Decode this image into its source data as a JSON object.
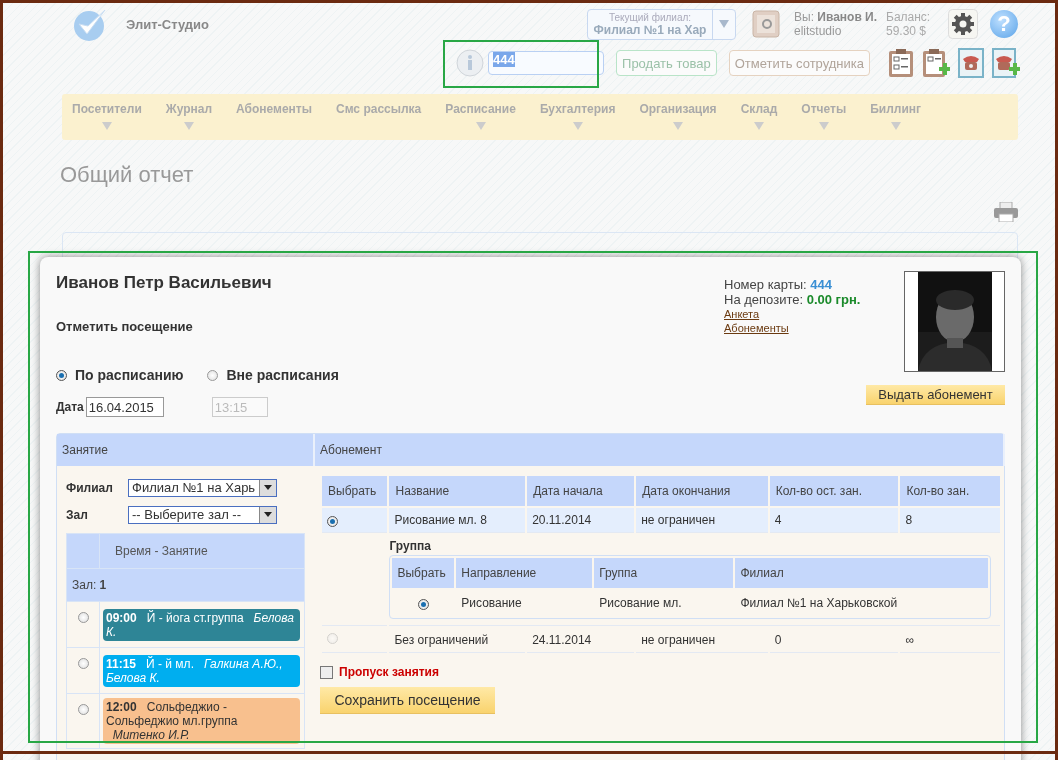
{
  "header": {
    "logo_text": "Элит-Студио",
    "branch_selector": {
      "label": "Текущий филиал:",
      "value": "Филиал №1 на Хар"
    },
    "user": {
      "prefix": "Вы:",
      "name": "Иванов И.",
      "login": "elitstudio"
    },
    "balance": {
      "label": "Баланс:",
      "value": "59.30 $"
    },
    "help": "?"
  },
  "search": {
    "value": "444"
  },
  "actions": [
    {
      "label": "Продать товар",
      "kind": "green"
    },
    {
      "label": "Отметить сотрудника",
      "kind": "brown"
    }
  ],
  "nav": [
    {
      "label": "Посетители",
      "has_menu": true
    },
    {
      "label": "Журнал",
      "has_menu": true
    },
    {
      "label": "Абонементы",
      "has_menu": false
    },
    {
      "label": "Смс рассылка",
      "has_menu": false
    },
    {
      "label": "Расписание",
      "has_menu": true
    },
    {
      "label": "Бухгалтерия",
      "has_menu": true
    },
    {
      "label": "Организация",
      "has_menu": true
    },
    {
      "label": "Склад",
      "has_menu": true
    },
    {
      "label": "Отчеты",
      "has_menu": true
    },
    {
      "label": "Биллинг",
      "has_menu": true
    }
  ],
  "page_title": "Общий отчет",
  "modal": {
    "client_name": "Иванов Петр Васильевич",
    "section_title": "Отметить посещение",
    "card": {
      "number_label": "Номер карты:",
      "number": "444",
      "deposit_label": "На депозите:",
      "deposit": "0.00 грн."
    },
    "links": [
      "Анкета",
      "Абонементы"
    ],
    "issue_button": "Выдать абонемент",
    "modes": [
      {
        "label": "По расписанию",
        "selected": true
      },
      {
        "label": "Вне расписания",
        "selected": false
      }
    ],
    "date_label": "Дата",
    "date": "16.04.2015",
    "time": "13:15",
    "lesson_panel": {
      "title": "Занятие",
      "branch_label": "Филиал",
      "branch_value": "Филиал №1 на Харь",
      "hall_label": "Зал",
      "hall_value": "-- Выберите зал --",
      "column": "Время - Занятие",
      "group_prefix": "Зал:",
      "group_value": "1",
      "lessons": [
        {
          "time": "09:00",
          "name": "Й - йога ст.группа",
          "teacher": "Белова К.",
          "color": "#2e8596",
          "selected": false
        },
        {
          "time": "11:15",
          "name": "Й - й мл.",
          "teacher": "Галкина А.Ю., Белова К.",
          "color": "#00aeef",
          "selected": false
        },
        {
          "time": "12:00",
          "name": "Сольфеджио - Сольфеджио мл.группа",
          "teacher": "Митенко И.Р.",
          "color": "#f8c08e",
          "selected": false
        }
      ]
    },
    "subscription_panel": {
      "title": "Абонемент",
      "select_column": "Выбрать",
      "columns": [
        "Название",
        "Дата начала",
        "Дата окончания",
        "Кол-во ост. зан.",
        "Кол-во зан."
      ],
      "rows": [
        {
          "selected": true,
          "disabled": false,
          "cells": [
            "Рисование мл. 8",
            "20.11.2014",
            "не ограничен",
            "4",
            "8"
          ],
          "group": {
            "title": "Группа",
            "select_column": "Выбрать",
            "columns": [
              "Направление",
              "Группа",
              "Филиал"
            ],
            "rows": [
              {
                "selected": true,
                "cells": [
                  "Рисование",
                  "Рисование мл.",
                  "Филиал №1 на Харьковской"
                ]
              }
            ]
          }
        },
        {
          "selected": false,
          "disabled": true,
          "cells": [
            "Без ограничений",
            "24.11.2014",
            "не ограничен",
            "0",
            "∞"
          ]
        }
      ],
      "skip": {
        "label": "Пропуск занятия",
        "checked": false
      },
      "save_button": "Сохранить посещение"
    }
  }
}
